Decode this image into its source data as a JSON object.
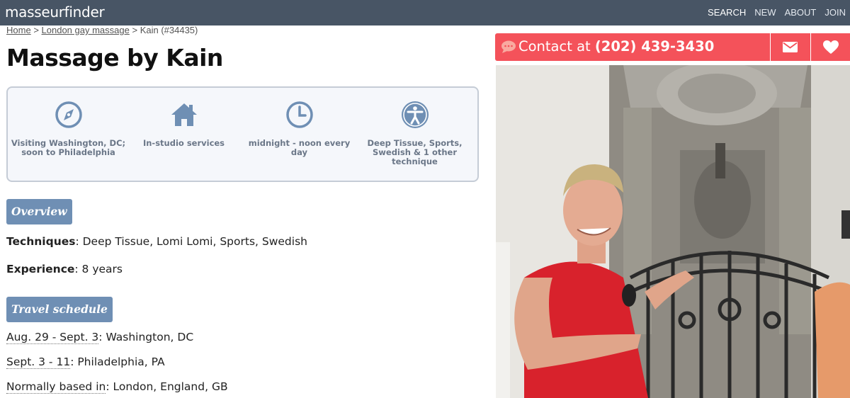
{
  "header": {
    "logo": "masseurfinder",
    "nav": [
      {
        "label": "SEARCH"
      },
      {
        "label": "NEW"
      },
      {
        "label": "ABOUT"
      },
      {
        "label": "JOIN"
      }
    ]
  },
  "breadcrumb": {
    "home": "Home",
    "category": "London gay massage",
    "current": "Kain (#34435)",
    "separator": ">"
  },
  "page_title": "Massage by Kain",
  "features": [
    {
      "icon": "compass-icon",
      "text": "Visiting Washington, DC; soon to Philadelphia"
    },
    {
      "icon": "house-icon",
      "text": "In-studio services"
    },
    {
      "icon": "clock-icon",
      "text": "midnight - noon every day"
    },
    {
      "icon": "accessibility-icon",
      "text": "Deep Tissue, Sports, Swedish & 1 other technique"
    }
  ],
  "overview": {
    "label": "Overview",
    "techniques_label": "Techniques",
    "techniques_value": ": Deep Tissue, Lomi Lomi, Sports, Swedish",
    "experience_label": "Experience",
    "experience_value": ": 8 years"
  },
  "travel": {
    "label": "Travel schedule",
    "items": [
      {
        "dates": "Aug. 29 - Sept. 3",
        "place": ": Washington, DC"
      },
      {
        "dates": "Sept. 3 - 11",
        "place": ": Philadelphia, PA"
      }
    ],
    "based_label": "Normally based in",
    "based_value": ": London, England, GB"
  },
  "contact": {
    "prefix": "Contact at",
    "phone": "(202) 439-3430"
  },
  "colors": {
    "topbar": "#485565",
    "accent_red": "#f4525a",
    "icon_blue": "#6f8fb4",
    "tag_bg": "#6f8fb4"
  }
}
